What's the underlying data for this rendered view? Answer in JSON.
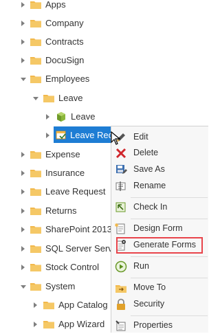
{
  "tree": {
    "items": [
      {
        "label": "Apps",
        "expanded": false
      },
      {
        "label": "Company",
        "expanded": false
      },
      {
        "label": "Contracts",
        "expanded": false
      },
      {
        "label": "DocuSign",
        "expanded": false
      },
      {
        "label": "Employees",
        "expanded": true
      },
      {
        "label": "Leave",
        "expanded": true
      },
      {
        "label": "Leave",
        "icon": "smartobject-cube-icon"
      },
      {
        "label": "Leave Requ",
        "icon": "form-icon",
        "selected": true
      },
      {
        "label": "Expense",
        "expanded": false
      },
      {
        "label": "Insurance",
        "expanded": false
      },
      {
        "label": "Leave Request",
        "expanded": false
      },
      {
        "label": "Returns",
        "expanded": false
      },
      {
        "label": "SharePoint 2013",
        "expanded": false
      },
      {
        "label": "SQL Server Servic",
        "expanded": false
      },
      {
        "label": "Stock Control",
        "expanded": false
      },
      {
        "label": "System",
        "expanded": true
      },
      {
        "label": "App Catalog",
        "expanded": false
      },
      {
        "label": "App Wizard",
        "expanded": false
      }
    ]
  },
  "context_menu": {
    "items": [
      {
        "label": "Edit",
        "icon": "pencil-icon"
      },
      {
        "label": "Delete",
        "icon": "delete-x-icon"
      },
      {
        "label": "Save As",
        "icon": "save-as-icon"
      },
      {
        "label": "Rename",
        "icon": "rename-icon"
      },
      {
        "label": "Check In",
        "icon": "check-in-icon"
      },
      {
        "label": "Design Form",
        "icon": "design-form-icon"
      },
      {
        "label": "Generate Forms",
        "icon": "generate-forms-icon",
        "highlighted": true
      },
      {
        "label": "Run",
        "icon": "run-icon"
      },
      {
        "label": "Move To",
        "icon": "move-to-icon"
      },
      {
        "label": "Security",
        "icon": "lock-icon"
      },
      {
        "label": "Properties",
        "icon": "properties-icon"
      }
    ]
  },
  "colors": {
    "selection": "#1e7dd4",
    "folder": "#f2b84b",
    "highlight_box": "#e8434a"
  }
}
